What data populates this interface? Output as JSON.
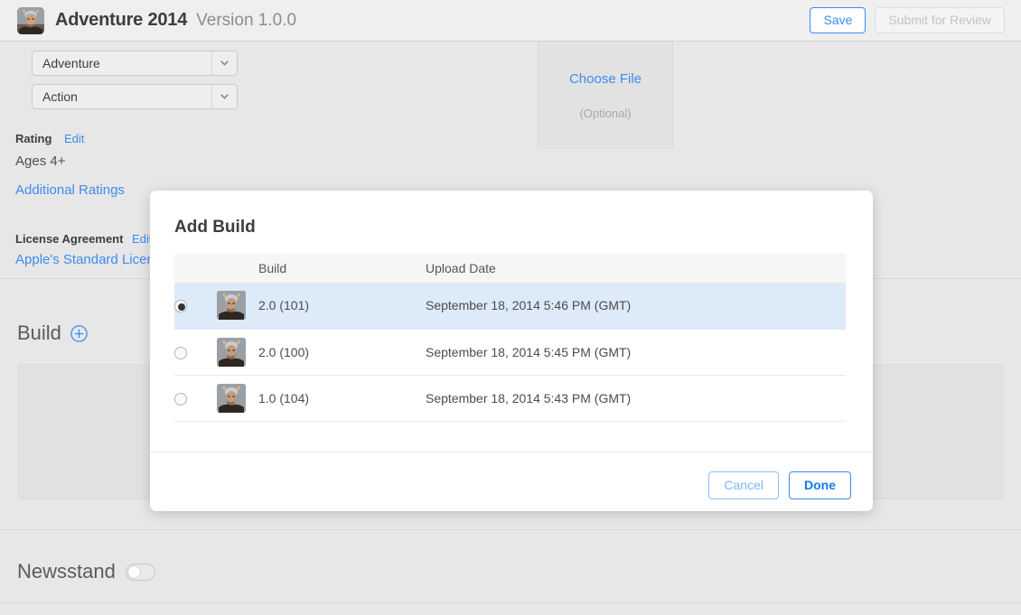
{
  "header": {
    "app_icon": "viking-app-icon",
    "title": "Adventure 2014",
    "version": "Version 1.0.0",
    "save_label": "Save",
    "submit_label": "Submit for Review"
  },
  "form": {
    "genre_primary": "Adventure",
    "genre_secondary": "Action",
    "rating_label": "Rating",
    "rating_edit": "Edit",
    "rating_value": "Ages 4+",
    "additional_ratings": "Additional Ratings",
    "license_label": "License Agreement",
    "license_edit": "Edit",
    "license_value": "Apple's Standard License Agreement",
    "choose_file": "Choose File",
    "choose_file_optional": "(Optional)"
  },
  "build_section": {
    "heading": "Build",
    "add_icon": "plus-circle-icon"
  },
  "newsstand_section": {
    "label": "Newsstand",
    "toggle_state": "off"
  },
  "modal": {
    "title": "Add Build",
    "columns": [
      "",
      "",
      "Build",
      "Upload Date"
    ],
    "rows": [
      {
        "selected": true,
        "icon": "viking-build-icon",
        "build": "2.0 (101)",
        "upload_date": "September 18, 2014 5:46 PM (GMT)"
      },
      {
        "selected": false,
        "icon": "viking-build-icon",
        "build": "2.0 (100)",
        "upload_date": "September 18, 2014 5:45 PM (GMT)"
      },
      {
        "selected": false,
        "icon": "viking-build-icon",
        "build": "1.0 (104)",
        "upload_date": "September 18, 2014 5:43 PM (GMT)"
      }
    ],
    "cancel_label": "Cancel",
    "done_label": "Done"
  },
  "colors": {
    "accent_blue": "#3b8cf0",
    "selected_row": "#ddeaf8",
    "page_background": "#e7e7e7",
    "header_background": "#efefef"
  }
}
